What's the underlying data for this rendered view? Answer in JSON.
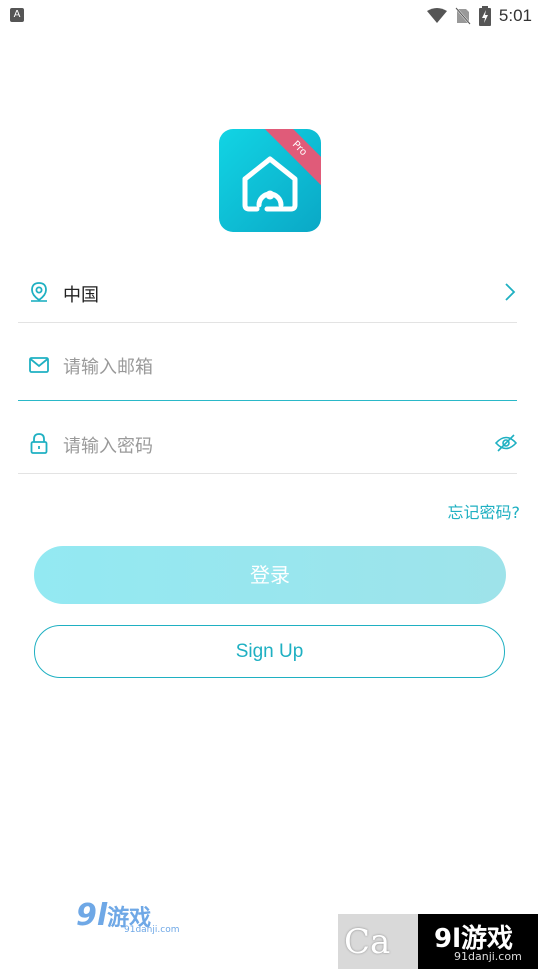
{
  "status_bar": {
    "left_icon_letter": "A",
    "time": "5:01"
  },
  "logo": {
    "badge": "Pro"
  },
  "form": {
    "region_value": "中国",
    "email_placeholder": "请输入邮箱",
    "password_placeholder": "请输入密码",
    "forgot_password": "忘记密码?"
  },
  "buttons": {
    "login": "登录",
    "signup": "Sign Up"
  },
  "watermarks": {
    "left_brand": "9l",
    "left_cn": "游戏",
    "left_url": "91danji.com",
    "right_prefix": "Ca",
    "right_brand": "9l游戏",
    "right_url": "91danji.com"
  },
  "colors": {
    "accent": "#1fb0c2",
    "login_button": "#9ee7ef",
    "pro_ribbon": "#e05b79"
  }
}
